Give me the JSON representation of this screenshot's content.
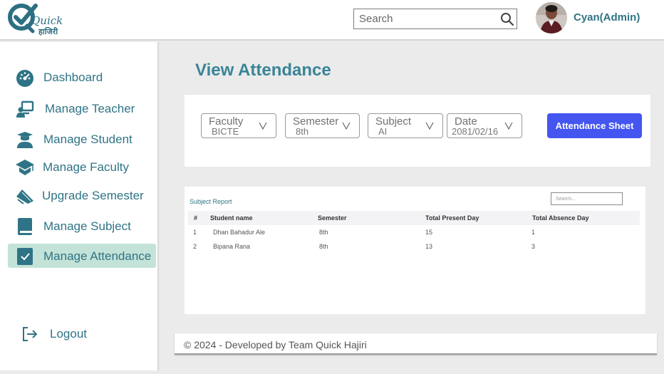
{
  "brand": {
    "logo_text": "Quick",
    "logo_subtext": "हाजिरी"
  },
  "header": {
    "search_placeholder": "Search",
    "user_name": "Cyan(Admin)"
  },
  "sidebar": {
    "items": [
      {
        "label": "Dashboard",
        "icon": "gauge-icon"
      },
      {
        "label": "Manage Teacher",
        "icon": "teacher-board-icon"
      },
      {
        "label": "Manage Student",
        "icon": "graduate-icon"
      },
      {
        "label": "Manage Faculty",
        "icon": "school-cap-icon"
      },
      {
        "label": "Upgrade Semester",
        "icon": "book-stack-icon"
      },
      {
        "label": "Manage Subject",
        "icon": "book-icon"
      },
      {
        "label": "Manage Attendance",
        "icon": "checkbox-icon",
        "active": true
      }
    ],
    "logout_label": "Logout"
  },
  "main": {
    "title": "View Attendance",
    "filters": [
      {
        "label": "Faculty",
        "value": "BICTE"
      },
      {
        "label": "Semester",
        "value": "8th"
      },
      {
        "label": "Subject",
        "value": "AI"
      },
      {
        "label": "Date",
        "value": "2081/02/16"
      }
    ],
    "attendance_button": "Attendance Sheet",
    "report": {
      "title": "Subject Report",
      "search_placeholder": "Search...",
      "columns": [
        "#",
        "Student name",
        "Semester",
        "Total Present Day",
        "Total Absence Day"
      ],
      "rows": [
        [
          "1",
          "Dhan Bahadur Ale",
          "8th",
          "15",
          "1"
        ],
        [
          "2",
          "Bipana Rana",
          "8th",
          "13",
          "3"
        ]
      ]
    }
  },
  "footer": {
    "text": "© 2024 - Developed by Team Quick Hajiri"
  },
  "colors": {
    "accent": "#2f7486",
    "button": "#4455f0",
    "active_bg": "#c4e3d8"
  }
}
